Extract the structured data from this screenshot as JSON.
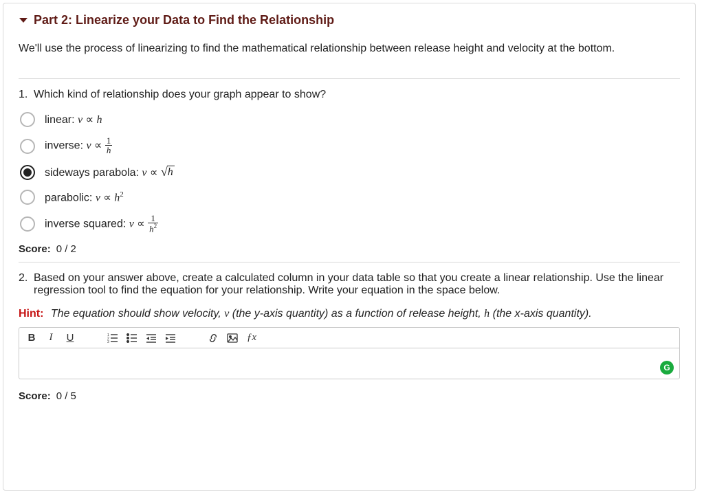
{
  "header": {
    "title": "Part 2: Linearize your Data to Find the Relationship"
  },
  "intro": "We'll use the process of linearizing to find the mathematical relationship between release height and velocity at the bottom.",
  "q1": {
    "number": "1.",
    "text": "Which kind of relationship does your graph appear to show?",
    "options": {
      "linear_label": "linear: ",
      "linear_rel_pre": "v",
      "linear_rel_op": " ∝ ",
      "linear_rel_post": "h",
      "inverse_label": "inverse: ",
      "inverse_pre": "v",
      "inverse_op": " ∝ ",
      "inverse_frac_num": "1",
      "inverse_frac_den": "h",
      "sideways_label": "sideways parabola: ",
      "sideways_pre": "v",
      "sideways_op": " ∝ ",
      "sideways_sqrt": "h",
      "parabolic_label": "parabolic: ",
      "parabolic_pre": "v",
      "parabolic_op": " ∝ ",
      "parabolic_post": "h",
      "parabolic_exp": "2",
      "invsq_label": "inverse squared: ",
      "invsq_pre": "v",
      "invsq_op": " ∝ ",
      "invsq_frac_num": "1",
      "invsq_frac_den_base": "h",
      "invsq_frac_den_exp": "2"
    },
    "score_label": "Score:",
    "score_value": "0 / 2"
  },
  "q2": {
    "number": "2.",
    "text": "Based on your answer above, create a calculated column in your data table so that you create a linear relationship. Use the linear regression tool to find the equation for your relationship. Write your equation in the space below.",
    "hint_label": "Hint:",
    "hint_text_a": "The equation should show velocity, ",
    "hint_v": "v",
    "hint_text_b": "  (the y-axis quantity) as a function of release height, ",
    "hint_h": "h",
    "hint_text_c": " (the x-axis quantity).",
    "score_label": "Score:",
    "score_value": "0 / 5"
  },
  "toolbar": {
    "bold": "B",
    "italic": "I",
    "underline": "U",
    "fx": "ƒx"
  },
  "badge": "G"
}
